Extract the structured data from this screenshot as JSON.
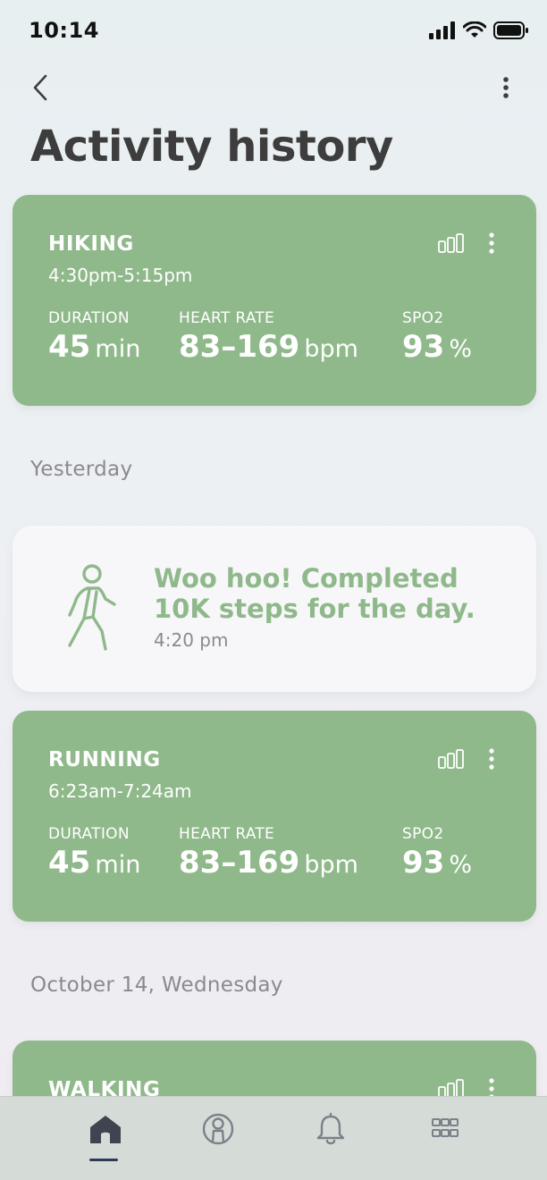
{
  "status_bar": {
    "time": "10:14"
  },
  "header": {
    "title": "Activity history"
  },
  "activities": [
    {
      "type": "HIKING",
      "time_range": "4:30pm-5:15pm",
      "duration_label": "DURATION",
      "duration_value": "45",
      "duration_unit": "min",
      "hr_label": "HEART RATE",
      "hr_value": "83–169",
      "hr_unit": "bpm",
      "spo2_label": "SPO2",
      "spo2_value": "93",
      "spo2_unit": "%"
    },
    {
      "type": "RUNNING",
      "time_range": "6:23am-7:24am",
      "duration_label": "DURATION",
      "duration_value": "45",
      "duration_unit": "min",
      "hr_label": "HEART RATE",
      "hr_value": "83–169",
      "hr_unit": "bpm",
      "spo2_label": "SPO2",
      "spo2_value": "93",
      "spo2_unit": "%"
    },
    {
      "type": "WALKING"
    }
  ],
  "sections": {
    "yesterday": "Yesterday",
    "oct14": "October 14, Wednesday"
  },
  "achievement": {
    "title": "Woo hoo! Completed 10K steps for the day.",
    "time": "4:20 pm"
  },
  "bottom_nav": {
    "tabs": [
      "home-icon",
      "profile-icon",
      "bell-icon",
      "grid-icon"
    ],
    "active": "home-icon"
  },
  "colors": {
    "card_green": "#8fb98a",
    "accent_green": "#8fb98a",
    "tab_indicator": "#2e3a5c"
  }
}
